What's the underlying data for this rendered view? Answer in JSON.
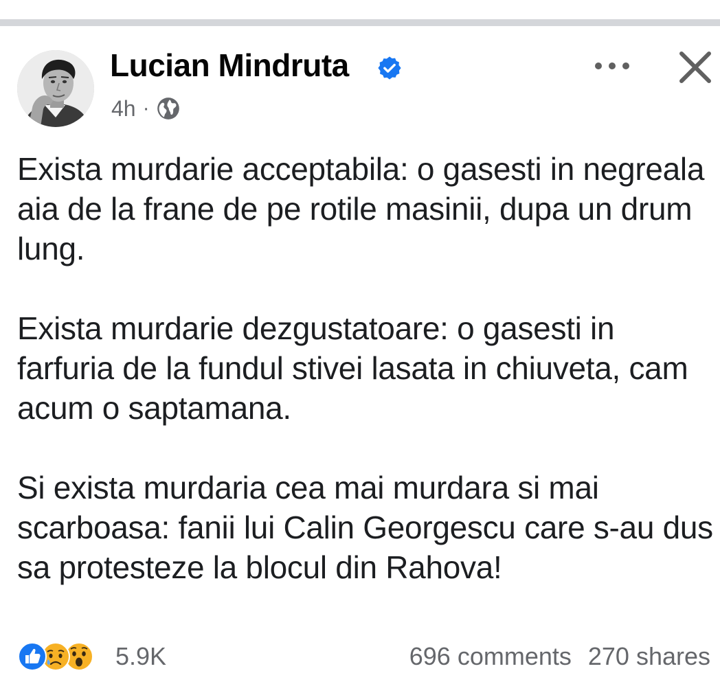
{
  "post": {
    "author": "Lucian Mindruta",
    "timestamp": "4h",
    "separator": "·",
    "audience_icon": "globe-icon",
    "verified_icon": "verified-badge-icon",
    "paragraphs": [
      "Exista murdarie acceptabila: o gasesti in negreala aia de la frane de pe rotile masinii, dupa un drum lung.",
      "Exista murdarie dezgustatoare: o gasesti in farfuria de la fundul stivei lasata in chiuveta, cam acum o saptamana.",
      "Si exista murdaria cea mai murdara si mai scarboasa: fanii lui Calin Georgescu care s-au dus sa   protesteze la blocul din Rahova!"
    ]
  },
  "footer": {
    "reaction_icons": [
      "like-icon",
      "sad-icon",
      "wow-icon"
    ],
    "reaction_count": "5.9K",
    "comments": "696 comments",
    "shares": "270 shares"
  },
  "colors": {
    "verified_blue": "#1877f2",
    "text": "#1c1e21",
    "secondary_text": "#65676b",
    "divider": "#d4d6da",
    "like_blue": "#1877f2",
    "emoji_yellow": "#f7b125"
  }
}
